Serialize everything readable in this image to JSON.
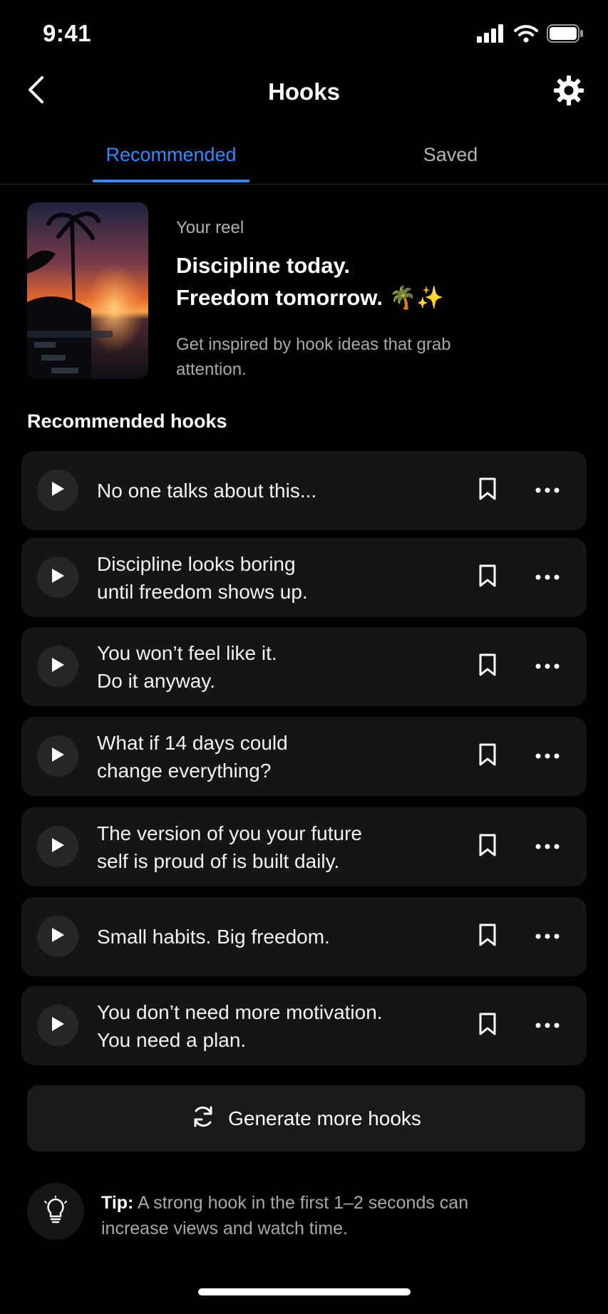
{
  "status_bar": {
    "time": "9:41"
  },
  "header": {
    "title": "Hooks",
    "back_icon": "chevron-left-icon",
    "settings_icon": "gear-icon"
  },
  "tabs": [
    {
      "label": "Recommended",
      "active": true
    },
    {
      "label": "Saved",
      "active": false
    }
  ],
  "reel": {
    "label": "Your reel",
    "caption_line1": "Discipline today.",
    "caption_line2": "Freedom tomorrow. 🌴✨",
    "description": "Get inspired by hook ideas that grab attention."
  },
  "section": {
    "title": "Recommended hooks"
  },
  "hooks": [
    {
      "text": "No one talks about this..."
    },
    {
      "text": "Discipline looks boring\nuntil freedom shows up."
    },
    {
      "text": "You won’t feel like it.\nDo it anyway."
    },
    {
      "text": "What if 14 days could\nchange everything?"
    },
    {
      "text": "The version of you your future\nself is proud of is built daily."
    },
    {
      "text": "Small habits. Big freedom."
    },
    {
      "text": "You don’t need more motivation.\nYou need a plan."
    }
  ],
  "generate": {
    "label": "Generate more hooks",
    "icon": "refresh-icon"
  },
  "tip": {
    "label": "Tip:",
    "text": " A strong hook in the first 1–2 seconds can increase views and watch time.",
    "icon": "lightbulb-icon"
  },
  "colors": {
    "accent": "#2f8cff",
    "background": "#000000",
    "card": "#151515"
  }
}
